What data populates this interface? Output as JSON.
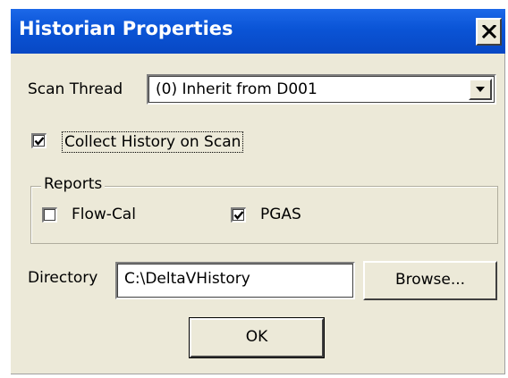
{
  "window": {
    "title": "Historian Properties",
    "close_glyph": "close-icon"
  },
  "scan_thread": {
    "label": "Scan Thread",
    "selected_value": "(0) Inherit from D001",
    "arrow_icon": "chevron-down-icon"
  },
  "collect_history": {
    "label": "Collect History on Scan",
    "checked": true
  },
  "reports": {
    "legend": "Reports",
    "options": [
      {
        "label": "Flow-Cal",
        "checked": false
      },
      {
        "label": "PGAS",
        "checked": true
      }
    ]
  },
  "directory": {
    "label": "Directory",
    "value": "C:\\DeltaVHistory",
    "browse_label": "Browse..."
  },
  "actions": {
    "ok_label": "OK"
  },
  "colors": {
    "titlebar": "#0a54d6",
    "dialog_bg": "#ece9d8",
    "title_text": "#ffffff"
  }
}
